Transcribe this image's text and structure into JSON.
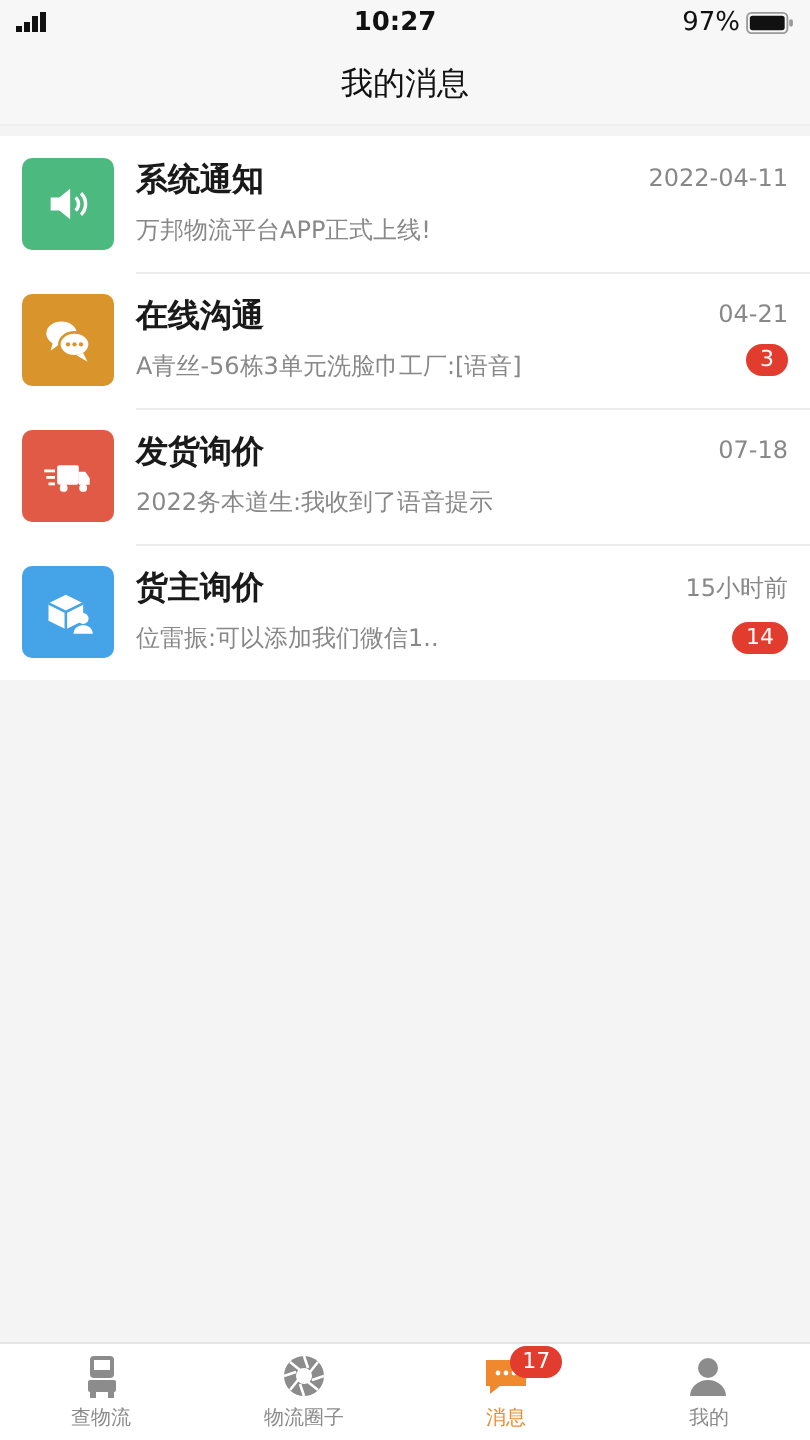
{
  "status_bar": {
    "time": "10:27",
    "battery": "97%"
  },
  "header": {
    "title": "我的消息"
  },
  "messages": [
    {
      "kind": "notice",
      "color": "#4cb97f",
      "title": "系统通知",
      "preview": "万邦物流平台APP正式上线!",
      "time": "2022-04-11"
    },
    {
      "kind": "chat",
      "color": "#d9952c",
      "title": "在线沟通",
      "preview": "A青丝-56栋3单元洗脸巾工厂:[语音]",
      "time": "04-21",
      "badge": "3"
    },
    {
      "kind": "truck",
      "color": "#e05a45",
      "title": "发货询价",
      "preview": "2022务本道生:我收到了语音提示",
      "time": "07-18"
    },
    {
      "kind": "cargo",
      "color": "#45a3e8",
      "title": "货主询价",
      "preview": "位雷振:可以添加我们微信1..",
      "time": "15小时前",
      "badge": "14"
    }
  ],
  "tabs": [
    {
      "kind": "truck",
      "label": "查物流",
      "selected": false
    },
    {
      "kind": "aperture",
      "label": "物流圈子",
      "selected": false
    },
    {
      "kind": "message",
      "label": "消息",
      "selected": true,
      "badge": "17"
    },
    {
      "kind": "person",
      "label": "我的",
      "selected": false
    }
  ]
}
